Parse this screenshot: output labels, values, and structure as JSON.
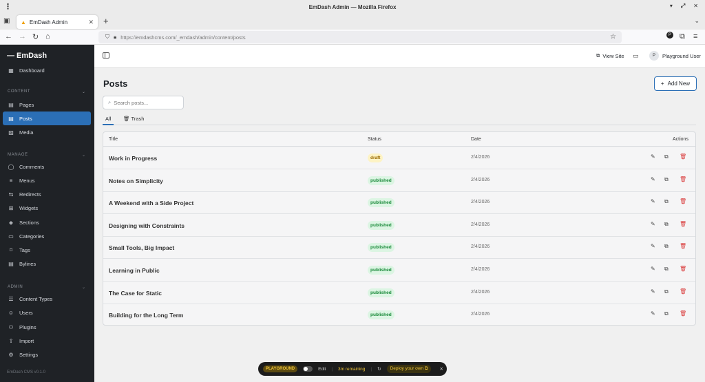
{
  "browser": {
    "window_title": "EmDash Admin — Mozilla Firefox",
    "tab_title": "EmDash Admin",
    "url": "https://emdashcms.com/_emdash/admin/content/posts"
  },
  "sidebar": {
    "brand": "— EmDash",
    "dashboard": "Dashboard",
    "sections": {
      "content": "CONTENT",
      "manage": "MANAGE",
      "admin": "ADMIN"
    },
    "content_items": [
      "Pages",
      "Posts",
      "Media"
    ],
    "manage_items": [
      "Comments",
      "Menus",
      "Redirects",
      "Widgets",
      "Sections",
      "Categories",
      "Tags",
      "Bylines"
    ],
    "admin_items": [
      "Content Types",
      "Users",
      "Plugins",
      "Import",
      "Settings"
    ],
    "version": "EmDash CMS v0.1.0"
  },
  "topbar": {
    "view_site": "View Site",
    "user_initial": "P",
    "user_name": "Playground User"
  },
  "page": {
    "title": "Posts",
    "add_new": "Add New",
    "search_placeholder": "Search posts...",
    "tabs": {
      "all": "All",
      "trash": "Trash"
    }
  },
  "table": {
    "headers": {
      "title": "Title",
      "status": "Status",
      "date": "Date",
      "actions": "Actions"
    },
    "rows": [
      {
        "title": "Work in Progress",
        "status": "draft",
        "date": "2/4/2026"
      },
      {
        "title": "Notes on Simplicity",
        "status": "published",
        "date": "2/4/2026"
      },
      {
        "title": "A Weekend with a Side Project",
        "status": "published",
        "date": "2/4/2026"
      },
      {
        "title": "Designing with Constraints",
        "status": "published",
        "date": "2/4/2026"
      },
      {
        "title": "Small Tools, Big Impact",
        "status": "published",
        "date": "2/4/2026"
      },
      {
        "title": "Learning in Public",
        "status": "published",
        "date": "2/4/2026"
      },
      {
        "title": "The Case for Static",
        "status": "published",
        "date": "2/4/2026"
      },
      {
        "title": "Building for the Long Term",
        "status": "published",
        "date": "2/4/2026"
      }
    ]
  },
  "playground": {
    "badge": "PLAYGROUND",
    "edit": "Edit",
    "remaining": "3m remaining",
    "deploy": "Deploy your own"
  },
  "colors": {
    "accent": "#2b6fb6",
    "sidebar_bg": "#1f2226",
    "draft_bg": "#fdf3c4",
    "draft_fg": "#9a6b00",
    "published_bg": "#dcf5e3",
    "published_fg": "#1a8a3a",
    "delete": "#d93a3a"
  }
}
